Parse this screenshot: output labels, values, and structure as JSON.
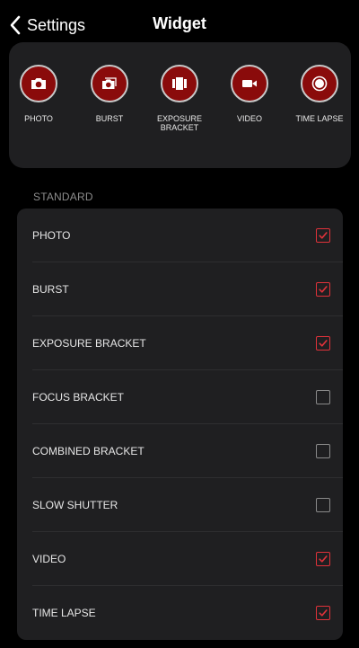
{
  "nav": {
    "back_label": "Settings",
    "title": "Widget"
  },
  "widget_preview": {
    "buttons": [
      {
        "label": "PHOTO",
        "icon": "camera-icon"
      },
      {
        "label": "BURST",
        "icon": "burst-icon"
      },
      {
        "label": "EXPOSURE BRACKET",
        "icon": "bracket-icon"
      },
      {
        "label": "VIDEO",
        "icon": "video-icon"
      },
      {
        "label": "TIME LAPSE",
        "icon": "record-icon"
      }
    ]
  },
  "section_label": "STANDARD",
  "items": [
    {
      "label": "PHOTO",
      "checked": true
    },
    {
      "label": "BURST",
      "checked": true
    },
    {
      "label": "EXPOSURE BRACKET",
      "checked": true
    },
    {
      "label": "FOCUS BRACKET",
      "checked": false
    },
    {
      "label": "COMBINED BRACKET",
      "checked": false
    },
    {
      "label": "SLOW SHUTTER",
      "checked": false
    },
    {
      "label": "VIDEO",
      "checked": true
    },
    {
      "label": "TIME LAPSE",
      "checked": true
    }
  ],
  "colors": {
    "accent": "#e0323a",
    "button_fill": "#8a0b0b",
    "panel": "#1f1f21"
  }
}
